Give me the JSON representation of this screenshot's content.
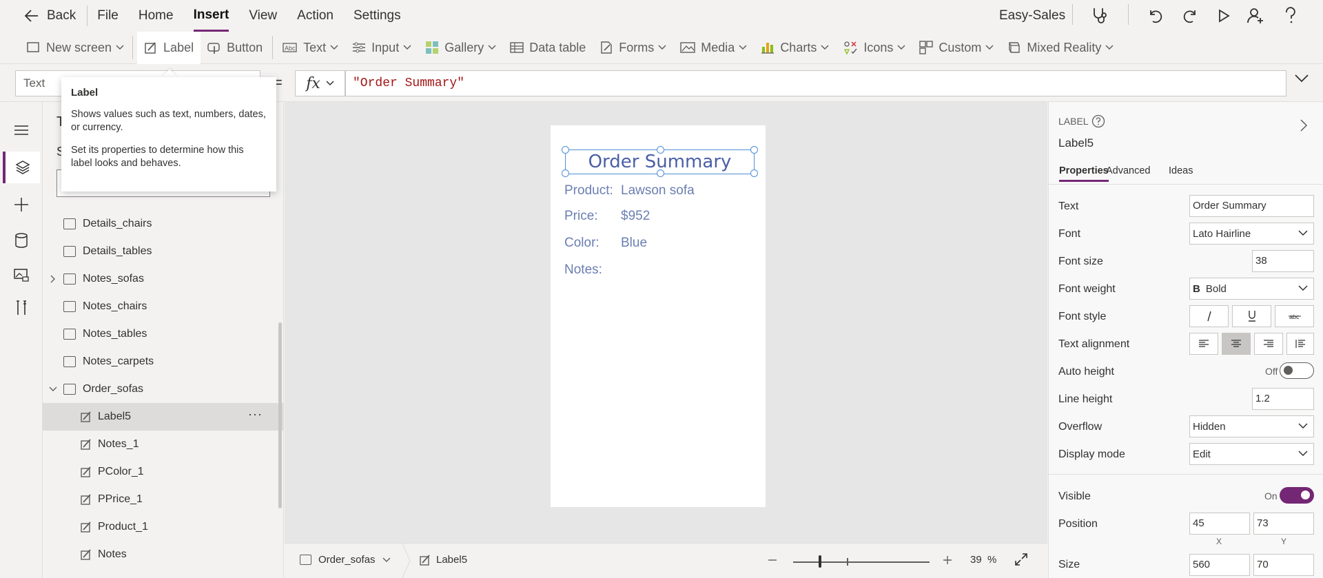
{
  "topbar": {
    "back_label": "Back",
    "menu": [
      "File",
      "Home",
      "Insert",
      "View",
      "Action",
      "Settings"
    ],
    "active_menu": "Insert",
    "app_name": "Easy-Sales"
  },
  "ribbon": {
    "items": [
      {
        "label": "New screen",
        "icon": "new-screen-icon",
        "dropdown": true
      },
      {
        "label": "Label",
        "icon": "label-icon",
        "dropdown": false
      },
      {
        "label": "Button",
        "icon": "button-icon",
        "dropdown": false
      },
      {
        "label": "Text",
        "icon": "text-icon",
        "dropdown": true
      },
      {
        "label": "Input",
        "icon": "input-icon",
        "dropdown": true
      },
      {
        "label": "Gallery",
        "icon": "gallery-icon",
        "dropdown": true
      },
      {
        "label": "Data table",
        "icon": "data-table-icon",
        "dropdown": false
      },
      {
        "label": "Forms",
        "icon": "forms-icon",
        "dropdown": true
      },
      {
        "label": "Media",
        "icon": "media-icon",
        "dropdown": true
      },
      {
        "label": "Charts",
        "icon": "charts-icon",
        "dropdown": true
      },
      {
        "label": "Icons",
        "icon": "icons-icon",
        "dropdown": true
      },
      {
        "label": "Custom",
        "icon": "custom-icon",
        "dropdown": true
      },
      {
        "label": "Mixed Reality",
        "icon": "mixed-reality-icon",
        "dropdown": true
      }
    ]
  },
  "formula_bar": {
    "property": "Text",
    "equals": "=",
    "fx": "fx",
    "formula": "\"Order Summary\""
  },
  "tooltip": {
    "title": "Label",
    "line1": "Shows values such as text, numbers, dates, or currency.",
    "line2": "Set its properties to determine how this label looks and behaves."
  },
  "tree": {
    "partial_header": "T",
    "partial_tab": "S",
    "nodes": [
      {
        "label": "Details_chairs",
        "type": "screen",
        "expand": false
      },
      {
        "label": "Details_tables",
        "type": "screen",
        "expand": false
      },
      {
        "label": "Notes_sofas",
        "type": "screen",
        "expand": "collapsed"
      },
      {
        "label": "Notes_chairs",
        "type": "screen",
        "expand": false
      },
      {
        "label": "Notes_tables",
        "type": "screen",
        "expand": false
      },
      {
        "label": "Notes_carpets",
        "type": "screen",
        "expand": false
      },
      {
        "label": "Order_sofas",
        "type": "screen",
        "expand": "expanded"
      },
      {
        "label": "Label5",
        "type": "label",
        "selected": true
      },
      {
        "label": "Notes_1",
        "type": "label"
      },
      {
        "label": "PColor_1",
        "type": "label"
      },
      {
        "label": "PPrice_1",
        "type": "label"
      },
      {
        "label": "Product_1",
        "type": "label"
      },
      {
        "label": "Notes",
        "type": "label"
      }
    ],
    "more_label": "···"
  },
  "canvas": {
    "title": "Order Summary",
    "rows": [
      {
        "label": "Product:",
        "value": "Lawson sofa"
      },
      {
        "label": "Price:",
        "value": "$952"
      },
      {
        "label": "Color:",
        "value": "Blue"
      },
      {
        "label": "Notes:",
        "value": ""
      }
    ]
  },
  "status": {
    "screen": "Order_sofas",
    "control": "Label5",
    "zoom": "39",
    "zoom_unit": "%"
  },
  "props": {
    "type": "LABEL",
    "name": "Label5",
    "tabs": [
      "Properties",
      "Advanced",
      "Ideas"
    ],
    "active_tab": "Properties",
    "text_label": "Text",
    "text_value": "Order Summary",
    "font_label": "Font",
    "font_value": "Lato Hairline",
    "font_size_label": "Font size",
    "font_size_value": "38",
    "font_weight_label": "Font weight",
    "font_weight_icon": "B",
    "font_weight_value": "Bold",
    "font_style_label": "Font style",
    "text_alignment_label": "Text alignment",
    "auto_height_label": "Auto height",
    "auto_height_value": "Off",
    "line_height_label": "Line height",
    "line_height_value": "1.2",
    "overflow_label": "Overflow",
    "overflow_value": "Hidden",
    "display_mode_label": "Display mode",
    "display_mode_value": "Edit",
    "visible_label": "Visible",
    "visible_value": "On",
    "position_label": "Position",
    "position_x": "45",
    "position_y": "73",
    "x_label": "X",
    "y_label": "Y",
    "size_label": "Size",
    "size_w": "560",
    "size_h": "70"
  },
  "colors": {
    "accent": "#742774",
    "selection": "#4f8fd6",
    "canvas_text": "#6b7eb2"
  }
}
